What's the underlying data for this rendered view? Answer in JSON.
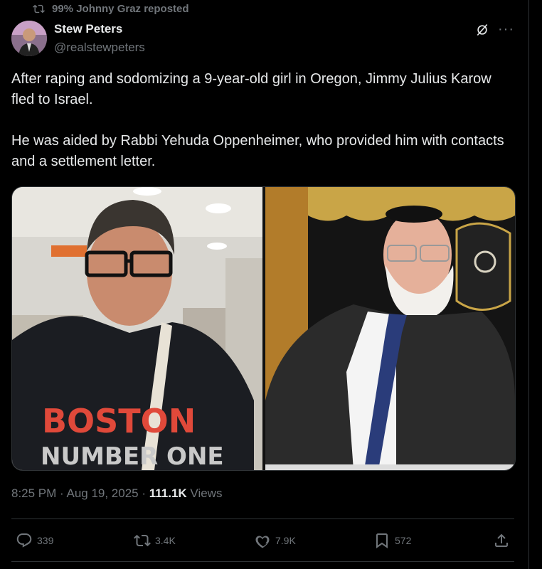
{
  "repost": {
    "text": "99% Johnny Graz reposted",
    "icon": "repost-icon"
  },
  "author": {
    "name": "Stew Peters",
    "handle": "@realstewpeters"
  },
  "post": {
    "text": "After raping and sodomizing a 9-year-old girl in Oregon, Jimmy Julius Karow fled to Israel.\n\nHe was aided by Rabbi Yehuda Oppenheimer, who provided him with contacts and a settlement letter.",
    "media_left_shirt": "BOSTON",
    "media_left_shirt2": "NUMBER ONE"
  },
  "meta": {
    "time": "8:25 PM · Aug 19, 2025 · ",
    "views_count": "111.1K",
    "views_label": " Views"
  },
  "actions": {
    "replies": "339",
    "reposts": "3.4K",
    "likes": "7.9K",
    "bookmarks": "572"
  },
  "colors": {
    "background": "#000000",
    "text": "#e7e9ea",
    "muted": "#71767b",
    "border": "#2f3336"
  }
}
